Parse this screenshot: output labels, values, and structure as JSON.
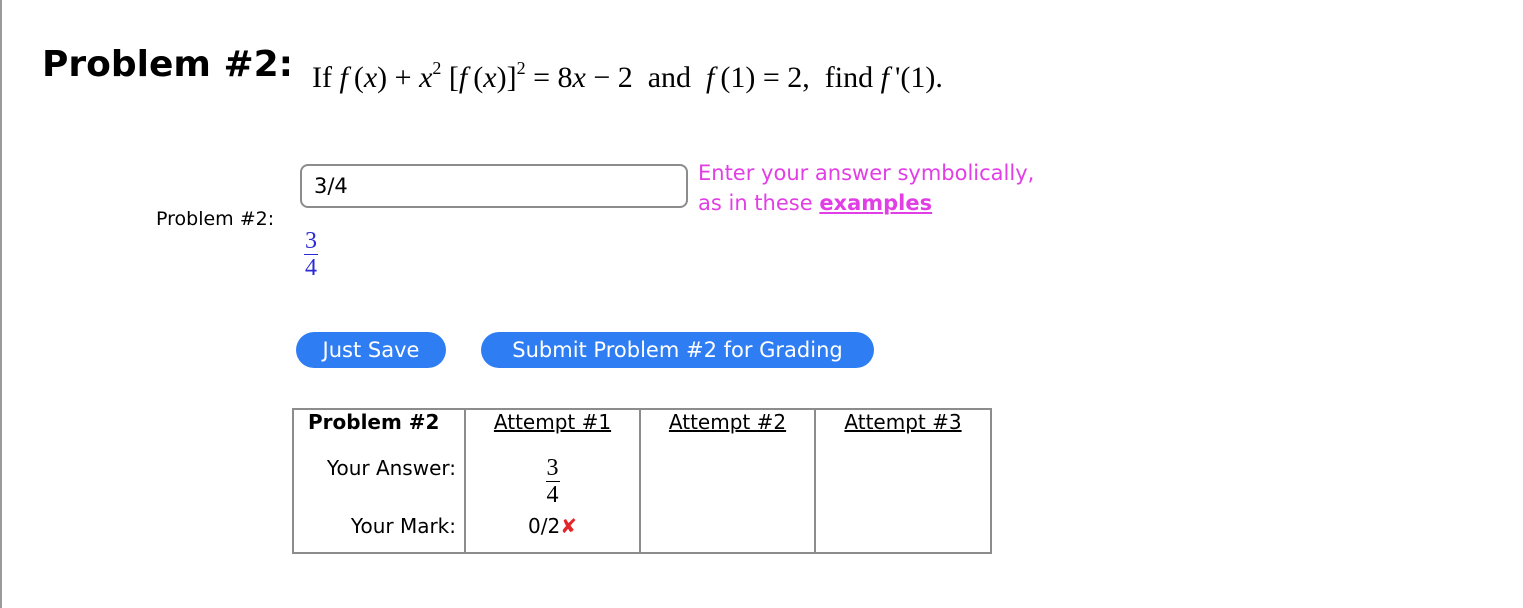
{
  "problem": {
    "heading": "Problem #2:",
    "side_label": "Problem #2:",
    "statement_text": "If f(x) + x2 [f(x)]2 = 8x − 2 and f(1) = 2, find f'(1)."
  },
  "answer": {
    "input_value": "3/4",
    "preview_numerator": "3",
    "preview_denominator": "4"
  },
  "hint": {
    "line1": "Enter your answer symbolically,",
    "line2_prefix": "as in these ",
    "link": "examples"
  },
  "buttons": {
    "save": "Just Save",
    "submit": "Submit Problem #2 for Grading"
  },
  "attempts_table": {
    "header": [
      "Problem #2",
      "Attempt #1",
      "Attempt #2",
      "Attempt #3"
    ],
    "answer_label": "Your Answer:",
    "mark_label": "Your Mark:",
    "attempt1_numerator": "3",
    "attempt1_denominator": "4",
    "attempt1_mark": "0/2",
    "attempt1_mark_symbol": "✘"
  },
  "colors": {
    "button_blue": "#2f7df3",
    "hint_magenta": "#e23ee6",
    "preview_blue": "#2a2ad6",
    "wrong_red": "#e3262b"
  }
}
